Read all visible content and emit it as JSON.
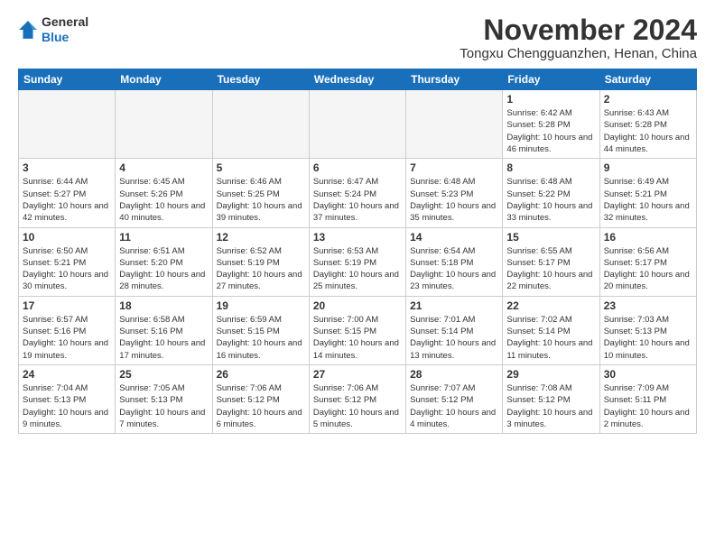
{
  "header": {
    "logo_line1": "General",
    "logo_line2": "Blue",
    "month_title": "November 2024",
    "location": "Tongxu Chengguanzhen, Henan, China"
  },
  "days_of_week": [
    "Sunday",
    "Monday",
    "Tuesday",
    "Wednesday",
    "Thursday",
    "Friday",
    "Saturday"
  ],
  "weeks": [
    [
      {
        "day": "",
        "empty": true
      },
      {
        "day": "",
        "empty": true
      },
      {
        "day": "",
        "empty": true
      },
      {
        "day": "",
        "empty": true
      },
      {
        "day": "",
        "empty": true
      },
      {
        "day": "1",
        "sunrise": "6:42 AM",
        "sunset": "5:28 PM",
        "daylight": "10 hours and 46 minutes."
      },
      {
        "day": "2",
        "sunrise": "6:43 AM",
        "sunset": "5:28 PM",
        "daylight": "10 hours and 44 minutes."
      }
    ],
    [
      {
        "day": "3",
        "sunrise": "6:44 AM",
        "sunset": "5:27 PM",
        "daylight": "10 hours and 42 minutes."
      },
      {
        "day": "4",
        "sunrise": "6:45 AM",
        "sunset": "5:26 PM",
        "daylight": "10 hours and 40 minutes."
      },
      {
        "day": "5",
        "sunrise": "6:46 AM",
        "sunset": "5:25 PM",
        "daylight": "10 hours and 39 minutes."
      },
      {
        "day": "6",
        "sunrise": "6:47 AM",
        "sunset": "5:24 PM",
        "daylight": "10 hours and 37 minutes."
      },
      {
        "day": "7",
        "sunrise": "6:48 AM",
        "sunset": "5:23 PM",
        "daylight": "10 hours and 35 minutes."
      },
      {
        "day": "8",
        "sunrise": "6:48 AM",
        "sunset": "5:22 PM",
        "daylight": "10 hours and 33 minutes."
      },
      {
        "day": "9",
        "sunrise": "6:49 AM",
        "sunset": "5:21 PM",
        "daylight": "10 hours and 32 minutes."
      }
    ],
    [
      {
        "day": "10",
        "sunrise": "6:50 AM",
        "sunset": "5:21 PM",
        "daylight": "10 hours and 30 minutes."
      },
      {
        "day": "11",
        "sunrise": "6:51 AM",
        "sunset": "5:20 PM",
        "daylight": "10 hours and 28 minutes."
      },
      {
        "day": "12",
        "sunrise": "6:52 AM",
        "sunset": "5:19 PM",
        "daylight": "10 hours and 27 minutes."
      },
      {
        "day": "13",
        "sunrise": "6:53 AM",
        "sunset": "5:19 PM",
        "daylight": "10 hours and 25 minutes."
      },
      {
        "day": "14",
        "sunrise": "6:54 AM",
        "sunset": "5:18 PM",
        "daylight": "10 hours and 23 minutes."
      },
      {
        "day": "15",
        "sunrise": "6:55 AM",
        "sunset": "5:17 PM",
        "daylight": "10 hours and 22 minutes."
      },
      {
        "day": "16",
        "sunrise": "6:56 AM",
        "sunset": "5:17 PM",
        "daylight": "10 hours and 20 minutes."
      }
    ],
    [
      {
        "day": "17",
        "sunrise": "6:57 AM",
        "sunset": "5:16 PM",
        "daylight": "10 hours and 19 minutes."
      },
      {
        "day": "18",
        "sunrise": "6:58 AM",
        "sunset": "5:16 PM",
        "daylight": "10 hours and 17 minutes."
      },
      {
        "day": "19",
        "sunrise": "6:59 AM",
        "sunset": "5:15 PM",
        "daylight": "10 hours and 16 minutes."
      },
      {
        "day": "20",
        "sunrise": "7:00 AM",
        "sunset": "5:15 PM",
        "daylight": "10 hours and 14 minutes."
      },
      {
        "day": "21",
        "sunrise": "7:01 AM",
        "sunset": "5:14 PM",
        "daylight": "10 hours and 13 minutes."
      },
      {
        "day": "22",
        "sunrise": "7:02 AM",
        "sunset": "5:14 PM",
        "daylight": "10 hours and 11 minutes."
      },
      {
        "day": "23",
        "sunrise": "7:03 AM",
        "sunset": "5:13 PM",
        "daylight": "10 hours and 10 minutes."
      }
    ],
    [
      {
        "day": "24",
        "sunrise": "7:04 AM",
        "sunset": "5:13 PM",
        "daylight": "10 hours and 9 minutes."
      },
      {
        "day": "25",
        "sunrise": "7:05 AM",
        "sunset": "5:13 PM",
        "daylight": "10 hours and 7 minutes."
      },
      {
        "day": "26",
        "sunrise": "7:06 AM",
        "sunset": "5:12 PM",
        "daylight": "10 hours and 6 minutes."
      },
      {
        "day": "27",
        "sunrise": "7:06 AM",
        "sunset": "5:12 PM",
        "daylight": "10 hours and 5 minutes."
      },
      {
        "day": "28",
        "sunrise": "7:07 AM",
        "sunset": "5:12 PM",
        "daylight": "10 hours and 4 minutes."
      },
      {
        "day": "29",
        "sunrise": "7:08 AM",
        "sunset": "5:12 PM",
        "daylight": "10 hours and 3 minutes."
      },
      {
        "day": "30",
        "sunrise": "7:09 AM",
        "sunset": "5:11 PM",
        "daylight": "10 hours and 2 minutes."
      }
    ]
  ]
}
